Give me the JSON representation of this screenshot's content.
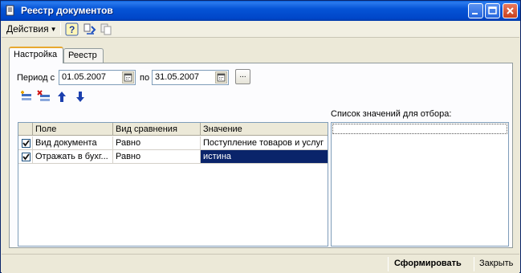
{
  "window": {
    "title": "Реестр документов"
  },
  "toolbar": {
    "actions_label": "Действия",
    "help_icon": "help-icon",
    "refresh_icon": "refresh-icon",
    "copy_icon": "copy-icon"
  },
  "tabs": [
    {
      "label": "Настройка"
    },
    {
      "label": "Реестр"
    }
  ],
  "period": {
    "from_label": "Период с",
    "from_value": "01.05.2007",
    "to_label": "по",
    "to_value": "31.05.2007",
    "more_button": "..."
  },
  "grid": {
    "columns": [
      "Поле",
      "Вид сравнения",
      "Значение"
    ],
    "rows": [
      {
        "checked": true,
        "field": "Вид документа",
        "comparison": "Равно",
        "value": "Поступление товаров и услуг"
      },
      {
        "checked": true,
        "field": "Отражать в бухг...",
        "comparison": "Равно",
        "value": "истина"
      }
    ]
  },
  "values_list": {
    "label": "Список значений для отбора:"
  },
  "footer": {
    "generate_label": "Сформировать",
    "close_label": "Закрыть"
  },
  "colors": {
    "title_bar": "#0054e3",
    "selection": "#0a246a",
    "background": "#ece9d8"
  }
}
